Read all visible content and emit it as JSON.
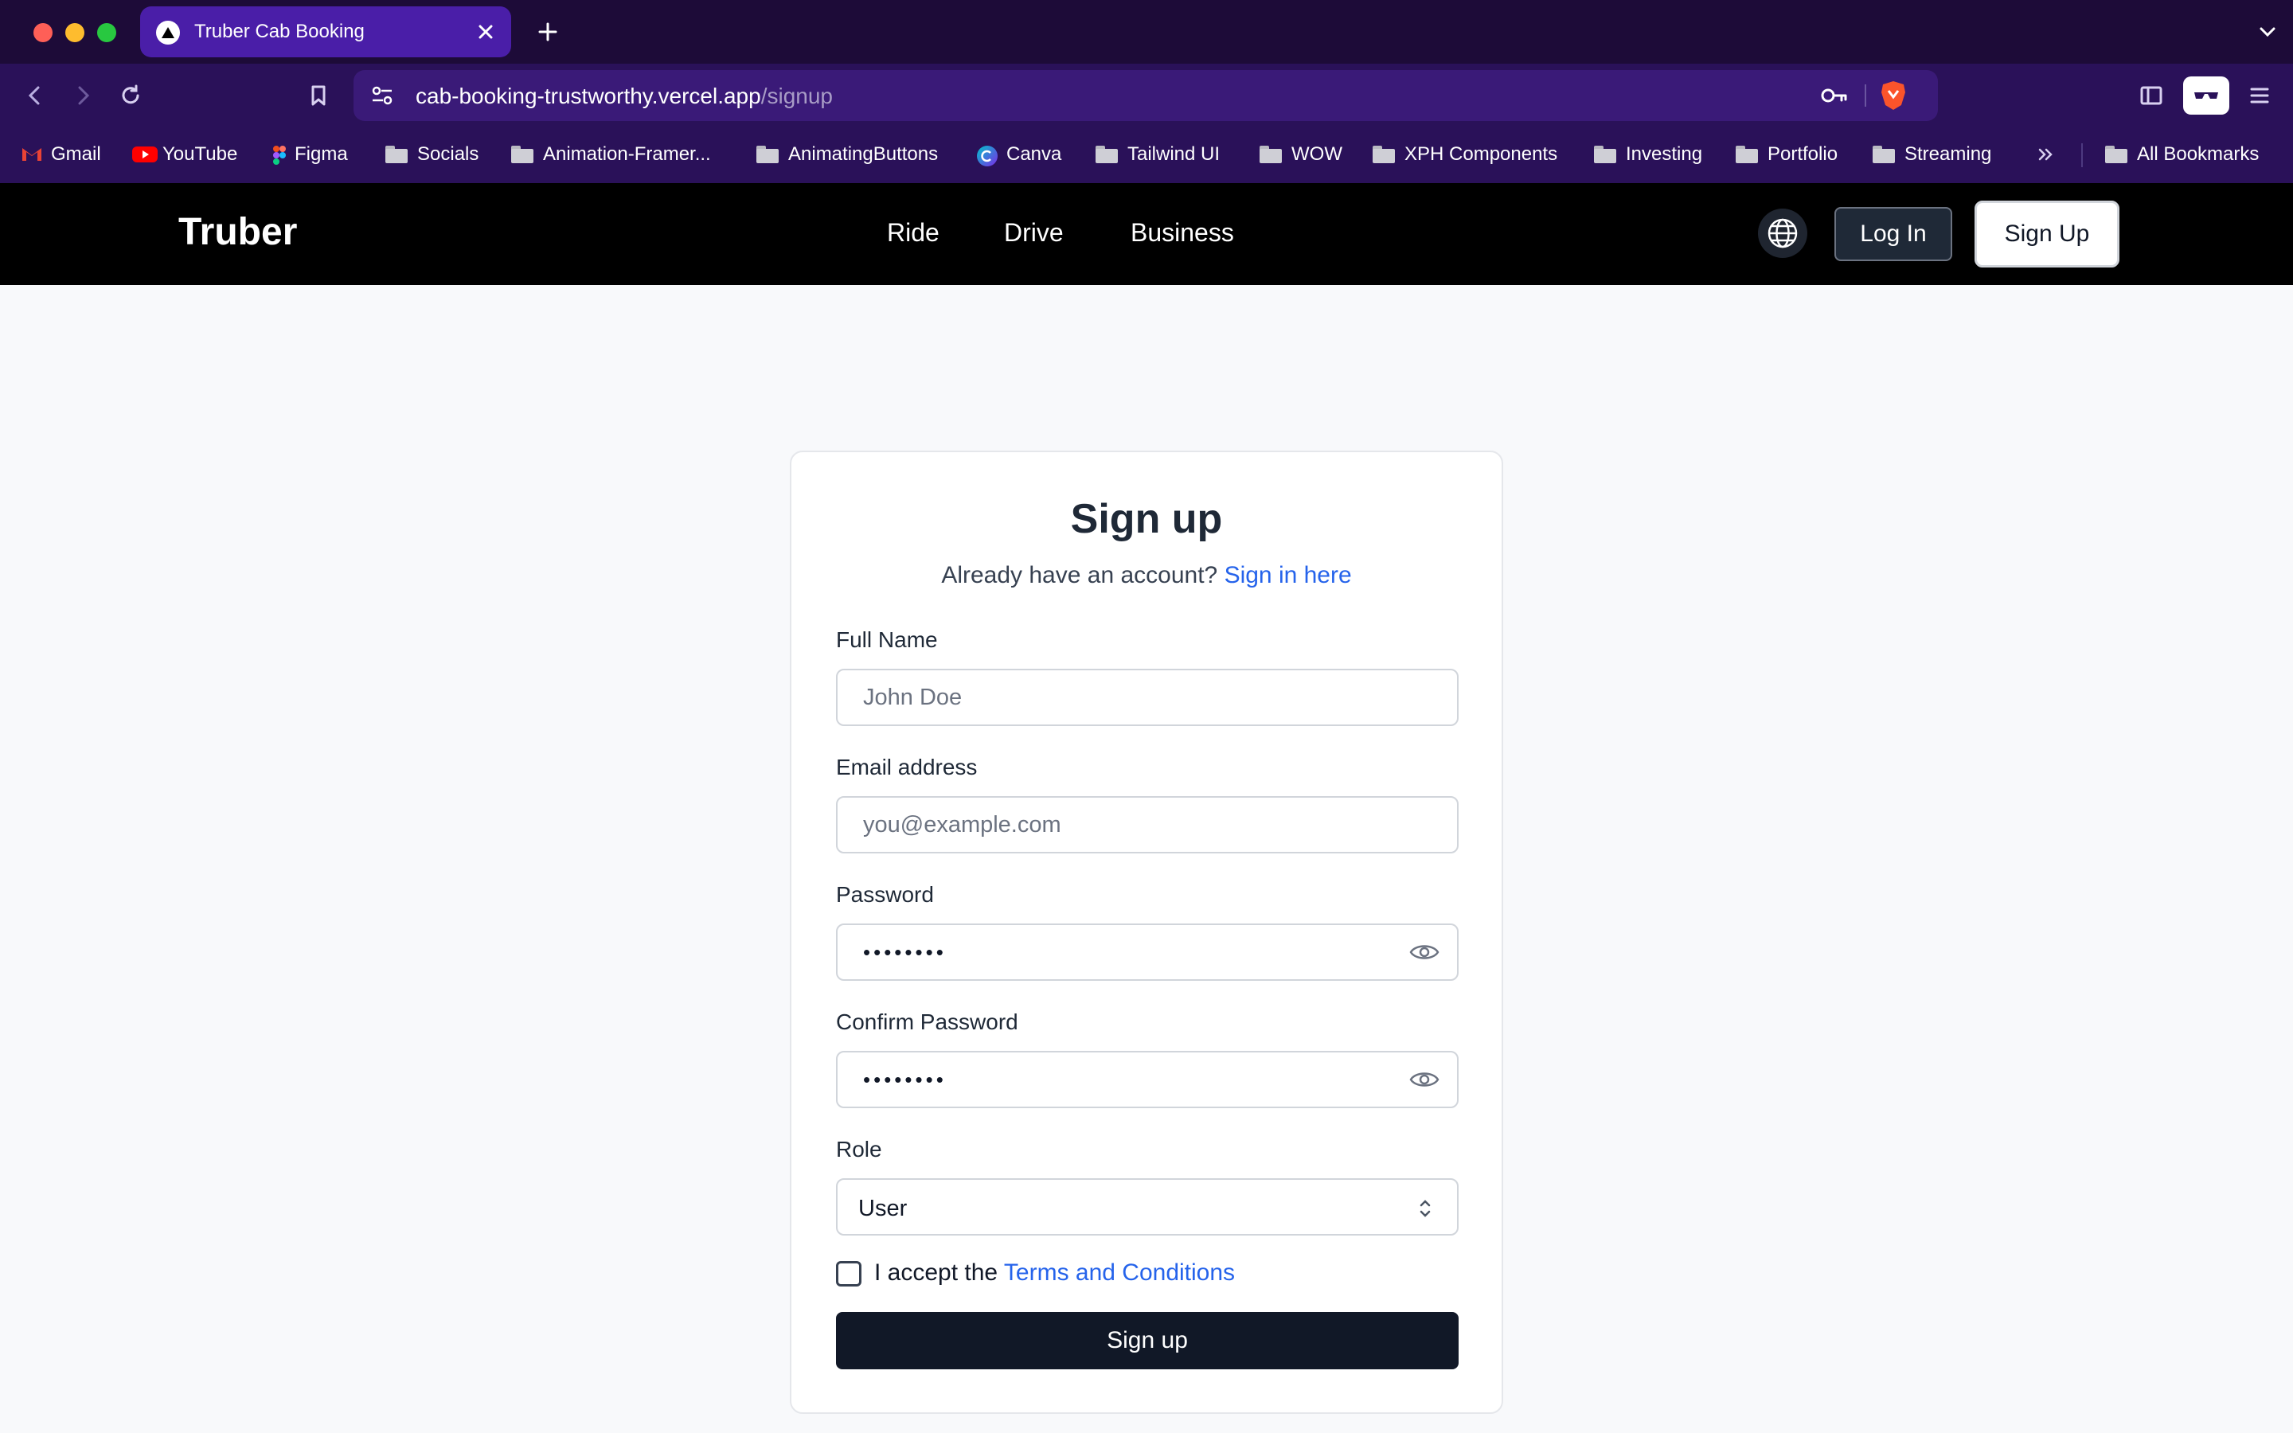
{
  "browser": {
    "tab_title": "Truber Cab Booking",
    "url_host": "cab-booking-trustworthy.vercel.app",
    "url_path": "/signup",
    "bookmarks": [
      {
        "label": "Gmail",
        "icon": "gmail-icon"
      },
      {
        "label": "YouTube",
        "icon": "youtube-icon"
      },
      {
        "label": "Figma",
        "icon": "figma-icon"
      },
      {
        "label": "Socials",
        "icon": "folder-icon"
      },
      {
        "label": "Animation-Framer...",
        "icon": "folder-icon"
      },
      {
        "label": "AnimatingButtons",
        "icon": "folder-icon"
      },
      {
        "label": "Canva",
        "icon": "canva-icon"
      },
      {
        "label": "Tailwind UI",
        "icon": "folder-icon"
      },
      {
        "label": "WOW",
        "icon": "folder-icon"
      },
      {
        "label": "XPH Components",
        "icon": "folder-icon"
      },
      {
        "label": "Investing",
        "icon": "folder-icon"
      },
      {
        "label": "Portfolio",
        "icon": "folder-icon"
      },
      {
        "label": "Streaming",
        "icon": "folder-icon"
      }
    ],
    "all_bookmarks": "All Bookmarks"
  },
  "site": {
    "logo": "Truber",
    "nav": [
      "Ride",
      "Drive",
      "Business"
    ],
    "login_label": "Log In",
    "signup_label": "Sign Up"
  },
  "form": {
    "title": "Sign up",
    "subtitle": "Already have an account?",
    "signin_link": "Sign in here",
    "full_name_label": "Full Name",
    "full_name_placeholder": "John Doe",
    "email_label": "Email address",
    "email_placeholder": "you@example.com",
    "password_label": "Password",
    "password_value": "••••••••",
    "confirm_label": "Confirm Password",
    "confirm_value": "••••••••",
    "role_label": "Role",
    "role_value": "User",
    "accept_text": "I accept the",
    "terms_link": "Terms and Conditions",
    "submit_label": "Sign up"
  },
  "colors": {
    "accent_link": "#2563eb",
    "header_bg": "#000000",
    "submit_bg": "#111827"
  }
}
